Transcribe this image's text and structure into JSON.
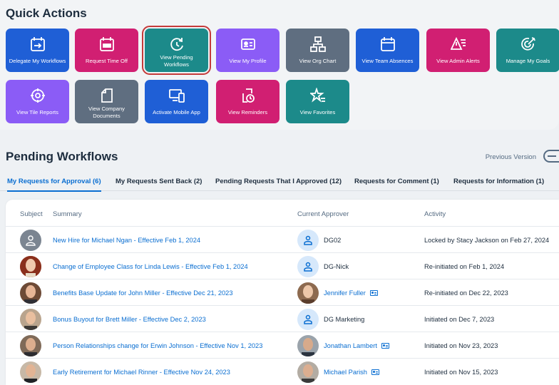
{
  "quick_actions": {
    "title": "Quick Actions",
    "tiles": [
      {
        "label": "Delegate My Workflows",
        "icon": "delegate-workflows-icon",
        "color": "#1f5fd6"
      },
      {
        "label": "Request Time Off",
        "icon": "calendar-icon",
        "color": "#d11f72"
      },
      {
        "label": "View Pending Workflows",
        "icon": "refresh-clock-icon",
        "color": "#1c8a8a"
      },
      {
        "label": "View My Profile",
        "icon": "id-card-icon",
        "color": "#8b5cf6"
      },
      {
        "label": "View Org Chart",
        "icon": "org-chart-icon",
        "color": "#5f6e80"
      },
      {
        "label": "View Team Absences",
        "icon": "calendar-outline-icon",
        "color": "#1f5fd6"
      },
      {
        "label": "View Admin Alerts",
        "icon": "alert-list-icon",
        "color": "#d11f72"
      },
      {
        "label": "Manage My Goals",
        "icon": "target-icon",
        "color": "#1c8a8a"
      },
      {
        "label": "View Tile Reports",
        "icon": "crosshair-icon",
        "color": "#8b5cf6"
      },
      {
        "label": "View Company Documents",
        "icon": "document-icon",
        "color": "#5f6e80"
      },
      {
        "label": "Activate Mobile App",
        "icon": "mobile-desktop-icon",
        "color": "#1f5fd6"
      },
      {
        "label": "View Reminders",
        "icon": "reminder-icon",
        "color": "#d11f72"
      },
      {
        "label": "View Favorites",
        "icon": "star-list-icon",
        "color": "#1c8a8a"
      }
    ]
  },
  "pending": {
    "title": "Pending Workflows",
    "previous_version": "Previous Version",
    "tabs": [
      "My Requests for Approval (6)",
      "My Requests Sent Back (2)",
      "Pending Requests That I Approved (12)",
      "Requests for Comment (1)",
      "Requests for Information (1)"
    ],
    "columns": {
      "subject": "Subject",
      "summary": "Summary",
      "approver": "Current Approver",
      "activity": "Activity"
    },
    "rows": [
      {
        "summary": "New Hire for Michael Ngan - Effective Feb 1, 2024",
        "approver": "DG02",
        "activity": "Locked by Stacy Jackson on Feb 27, 2024"
      },
      {
        "summary": "Change of Employee Class for Linda Lewis - Effective Feb 1, 2024",
        "approver": "DG-Nick",
        "activity": "Re-initiated on Feb 1, 2024"
      },
      {
        "summary": "Benefits Base Update for John Miller - Effective Dec 21, 2023",
        "approver": "Jennifer Fuller",
        "activity": "Re-initiated on Dec 22, 2023"
      },
      {
        "summary": "Bonus Buyout for Brett Miller - Effective Dec 2, 2023",
        "approver": "DG Marketing",
        "activity": "Initiated on Dec 7, 2023"
      },
      {
        "summary": "Person Relationships change for Erwin Johnson - Effective Nov 1, 2023",
        "approver": "Jonathan Lambert",
        "activity": "Initiated on Nov 23, 2023"
      },
      {
        "summary": "Early Retirement for Michael Rinner - Effective Nov 24, 2023",
        "approver": "Michael Parish",
        "activity": "Initiated on Nov 15, 2023"
      }
    ]
  }
}
